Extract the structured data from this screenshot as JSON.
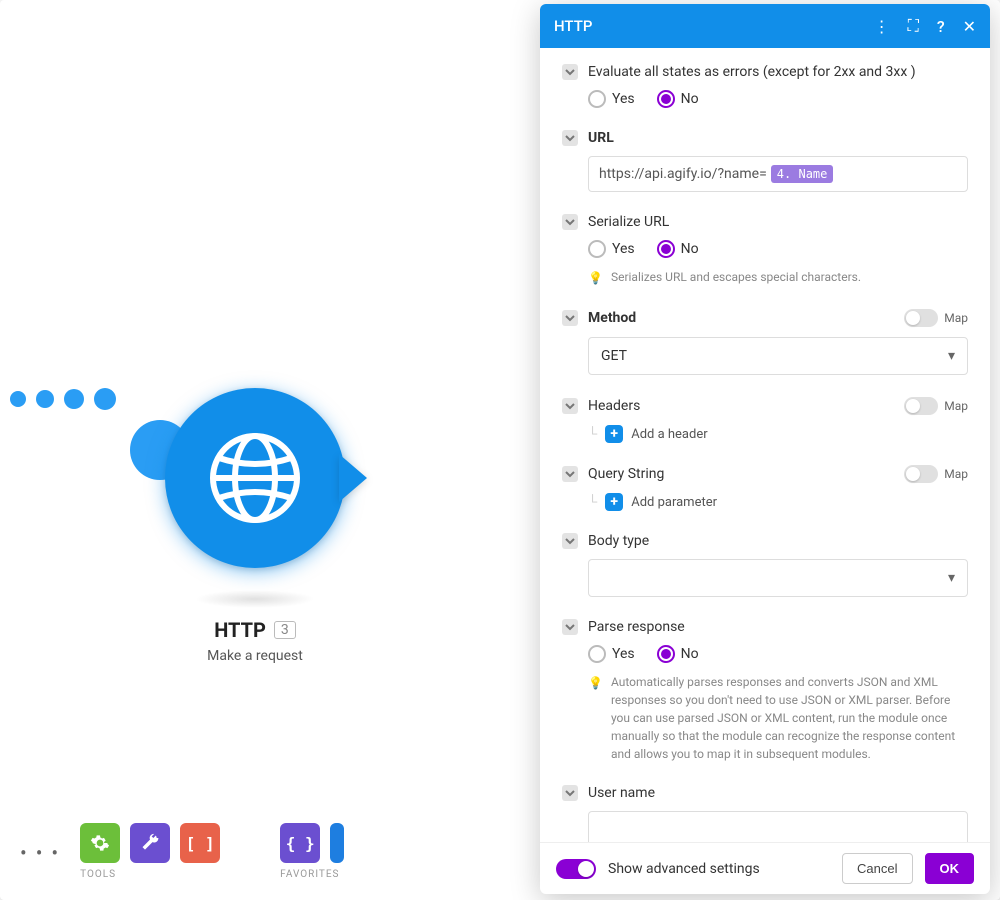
{
  "node": {
    "title": "HTTP",
    "badge": "3",
    "subtitle": "Make a request"
  },
  "toolbar": {
    "tools_label": "TOOLS",
    "favorites_label": "FAVORITES"
  },
  "panel": {
    "title": "HTTP",
    "fields": {
      "evaluate_errors": {
        "label": "Evaluate all states as errors (except for 2xx and 3xx )",
        "yes": "Yes",
        "no": "No",
        "value": "No"
      },
      "url": {
        "label": "URL",
        "text_value": "https://api.agify.io/?name=",
        "pill": "4. Name"
      },
      "serialize": {
        "label": "Serialize URL",
        "yes": "Yes",
        "no": "No",
        "value": "No",
        "hint": "Serializes URL and escapes special characters."
      },
      "method": {
        "label": "Method",
        "map": "Map",
        "value": "GET"
      },
      "headers": {
        "label": "Headers",
        "map": "Map",
        "add": "Add a header"
      },
      "query": {
        "label": "Query String",
        "map": "Map",
        "add": "Add parameter"
      },
      "body_type": {
        "label": "Body type"
      },
      "parse": {
        "label": "Parse response",
        "yes": "Yes",
        "no": "No",
        "value": "No",
        "hint": "Automatically parses responses and converts JSON and XML responses so you don't need to use JSON or XML parser. Before you can use parsed JSON or XML content, run the module once manually so that the module can recognize the response content and allows you to map it in subsequent modules."
      },
      "username": {
        "label": "User name"
      }
    },
    "footer": {
      "advanced": "Show advanced settings",
      "cancel": "Cancel",
      "ok": "OK"
    }
  }
}
